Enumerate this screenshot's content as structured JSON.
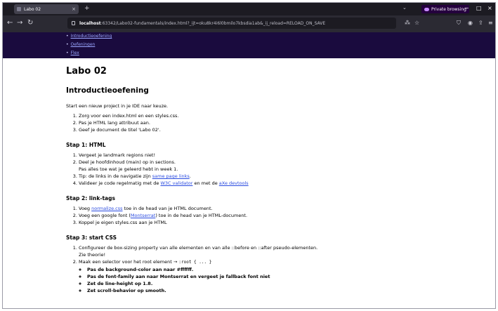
{
  "tab": {
    "title": "Labo 02",
    "close": "×",
    "new": "+"
  },
  "tab_dropdown": "⌄",
  "private": {
    "label": "Private browsing"
  },
  "window_controls": {
    "minimize": "−",
    "maximize": "□",
    "close": "×"
  },
  "toolbar": {
    "back": "←",
    "forward": "→",
    "reload": "↻",
    "url_host": "localhost",
    "url_rest": ":63342/Labo02-fundamentals/index.html?_ijt=oku8kr4i6l0bmilo7kbsdia1ab&_ij_reload=RELOAD_ON_SAVE",
    "translate": "⁂",
    "bookmark": "☆",
    "shield": "⛉",
    "account": "◉",
    "extensions": "⇪",
    "menu": "≡"
  },
  "sitenav": {
    "items": [
      "Introductieoefening",
      "Oefeningen",
      "Flex"
    ]
  },
  "content": {
    "title": "Labo 02",
    "intro_heading": "Introductieoefening",
    "intro_text": "Start een nieuw project in je IDE naar keuze.",
    "intro_steps": [
      "Zorg voor een index.html en een styles.css.",
      "Pas je HTML lang attribuut aan.",
      "Geef je document de titel 'Labo 02'."
    ],
    "step1_heading": "Stap 1: HTML",
    "step1": {
      "item1": "Vergeet je landmark regions niet!",
      "item2a": "Deel je hoofdinhoud (main) op in sections.",
      "item2b": "Pas alles toe wat je geleerd hebt in week 1.",
      "item3_pre": "Tip: de links in de navigatie zijn ",
      "item3_link": "same page links",
      "item3_post": ".",
      "item4_pre": "Valideer je code regelmatig met de ",
      "item4_link1": "W3C validator",
      "item4_mid": " en met de ",
      "item4_link2": "aXe devtools"
    },
    "step2_heading": "Stap 2: link-tags",
    "step2": {
      "item1_pre": "Voeg ",
      "item1_link": "normalize.css",
      "item1_post": " toe in de head van je HTML document.",
      "item2_pre": "Voeg een google font (",
      "item2_link": "Montserrat",
      "item2_post": ") toe in de head van je HTML-document.",
      "item3": "Koppel je eigen styles.css aan je HTML"
    },
    "step3_heading": "Stap 3: start CSS",
    "step3": {
      "item1a": "Configureer de box-sizing property van alle elementen en van alle ::before en ::after pseudo-elementen.",
      "item1b": "Zie theorie!",
      "item2_pre": "Maak een selector voor het root element → ",
      "item2_code": ":root { ... }",
      "sub": [
        "Pas de background-color aan naar #ffffff.",
        "Pas de font-family aan naar Montserrat en vergeet je fallback font niet",
        "Zet de line-height op 1.8.",
        "Zet scroll-behavior op smooth."
      ]
    }
  }
}
